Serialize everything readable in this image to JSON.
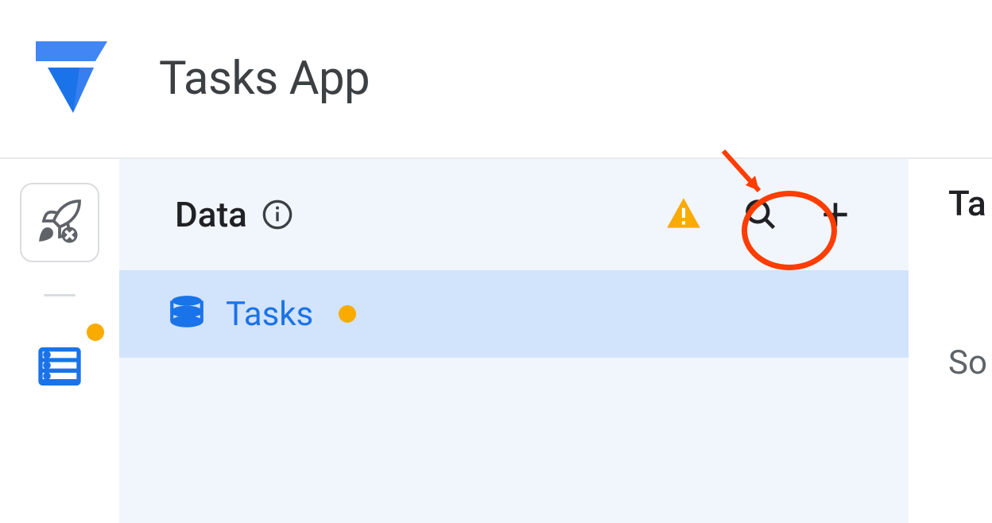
{
  "header": {
    "app_title": "Tasks App"
  },
  "data_panel": {
    "title": "Data",
    "tables": [
      {
        "name": "Tasks",
        "status": "warning"
      }
    ]
  },
  "right_panel": {
    "title_fragment": "Ta",
    "text_fragment": "So"
  },
  "colors": {
    "accent_blue": "#1a73e8",
    "warning_orange": "#f9ab00",
    "text_primary": "#202124",
    "text_secondary": "#5f6368",
    "selected_bg": "#d2e3fc",
    "panel_bg": "#f1f6fd",
    "annotation": "#ff3d00"
  }
}
